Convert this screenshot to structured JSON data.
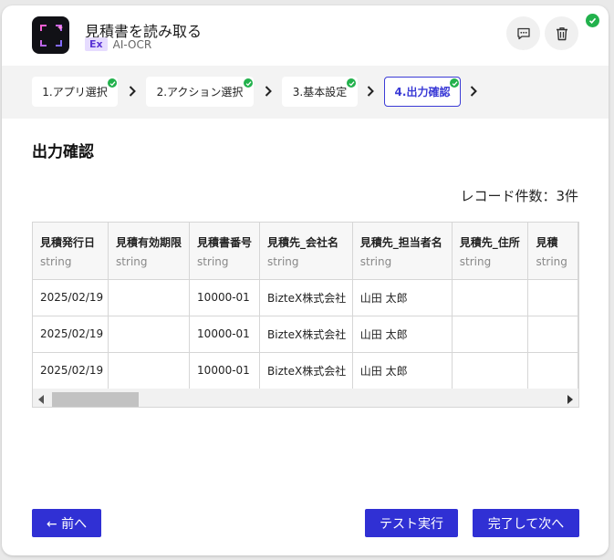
{
  "header": {
    "title": "見積書を読み取る",
    "badge": "Ex",
    "subtitle": "AI-OCR"
  },
  "steps": [
    {
      "label": "1.アプリ選択",
      "completed": true,
      "active": false
    },
    {
      "label": "2.アクション選択",
      "completed": true,
      "active": false
    },
    {
      "label": "3.基本設定",
      "completed": true,
      "active": false
    },
    {
      "label": "4.出力確認",
      "completed": true,
      "active": true
    }
  ],
  "main": {
    "section_title": "出力確認",
    "record_count": "レコード件数：3件"
  },
  "table": {
    "columns": [
      {
        "name": "見積発行日",
        "type": "string"
      },
      {
        "name": "見積有効期限",
        "type": "string"
      },
      {
        "name": "見積書番号",
        "type": "string"
      },
      {
        "name": "見積先_会社名",
        "type": "string"
      },
      {
        "name": "見積先_担当者名",
        "type": "string"
      },
      {
        "name": "見積先_住所",
        "type": "string"
      },
      {
        "name": "見積",
        "type": "string"
      }
    ],
    "rows": [
      [
        "2025/02/19",
        "",
        "10000-01",
        "BizteX株式会社",
        "山田 太郎",
        "",
        ""
      ],
      [
        "2025/02/19",
        "",
        "10000-01",
        "BizteX株式会社",
        "山田 太郎",
        "",
        ""
      ],
      [
        "2025/02/19",
        "",
        "10000-01",
        "BizteX株式会社",
        "山田 太郎",
        "",
        ""
      ]
    ]
  },
  "footer": {
    "back_label": "← 前へ",
    "test_label": "テスト実行",
    "next_label": "完了して次へ"
  },
  "colors": {
    "accent": "#3030d4",
    "success": "#22b14c",
    "badge_bg": "#e6dcff"
  },
  "icons": [
    "ocr-scan-icon",
    "comment-icon",
    "trash-icon",
    "check-circle-icon",
    "chevron-right-icon"
  ]
}
